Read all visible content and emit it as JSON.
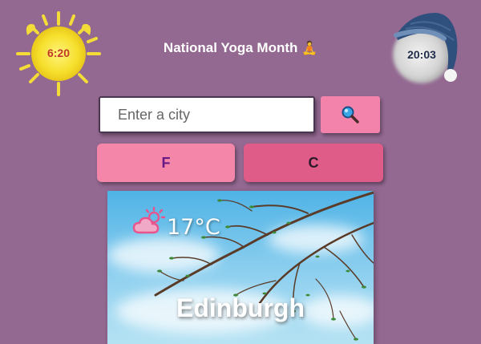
{
  "header": {
    "title": "National Yoga Month",
    "title_emoji": "🧘"
  },
  "sunrise": {
    "time": "6:20",
    "icon": "sun-icon"
  },
  "sunset": {
    "time": "20:03",
    "icon": "moon-with-nightcap-icon"
  },
  "search": {
    "placeholder": "Enter a city",
    "value": "",
    "button_icon": "magnifier-icon"
  },
  "units": {
    "fahrenheit_label": "F",
    "celsius_label": "C"
  },
  "weather": {
    "temperature": "17°C",
    "condition_icon": "cloud-sun-icon",
    "city": "Edinburgh"
  },
  "colors": {
    "background": "#936891",
    "accent_pink": "#f383aa",
    "accent_dark_pink": "#df5b88",
    "sun_yellow": "#f7e13a",
    "sunrise_time_color": "#c0392b",
    "sunset_time_color": "#1f2d4a"
  }
}
